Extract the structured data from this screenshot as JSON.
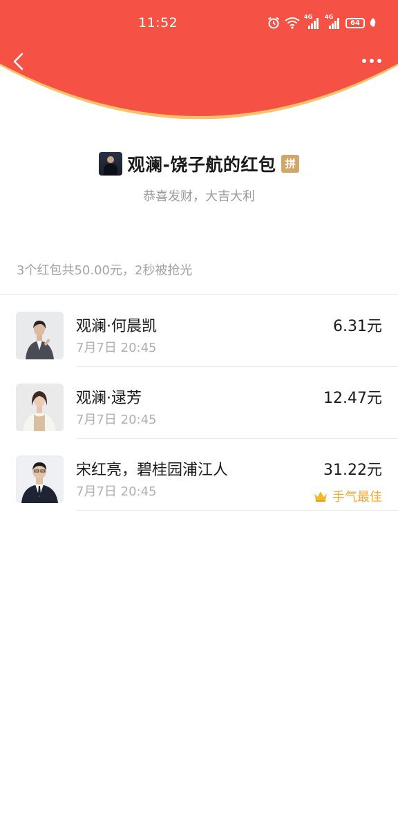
{
  "status_bar": {
    "time": "11:52",
    "signal_label_1": "4G",
    "signal_label_2": "4G",
    "battery": "64",
    "icons": [
      "alarm-icon",
      "wifi-icon",
      "signal-icon",
      "signal-icon",
      "battery-icon",
      "leaf-icon"
    ]
  },
  "nav": {
    "back_icon": "chevron-left-icon",
    "more_icon": "more-dots-icon"
  },
  "colors": {
    "header_red": "#f55145",
    "header_edge": "#f7c26a",
    "best_gold": "#f2a93b",
    "pin_badge": "#d2a86a"
  },
  "packet": {
    "title": "观澜-饶子航的红包",
    "pin_badge": "拼",
    "blessing": "恭喜发财，大吉大利"
  },
  "summary": "3个红包共50.00元，2秒被抢光",
  "records": [
    {
      "name": "观澜·何晨凯",
      "time": "7月7日  20:45",
      "amount": "6.31元",
      "best": ""
    },
    {
      "name": "观澜·逯芳",
      "time": "7月7日  20:45",
      "amount": "12.47元",
      "best": ""
    },
    {
      "name": "宋红亮，碧桂园浦江人",
      "time": "7月7日  20:45",
      "amount": "31.22元",
      "best": "手气最佳",
      "best_icon": "crown-icon"
    }
  ]
}
